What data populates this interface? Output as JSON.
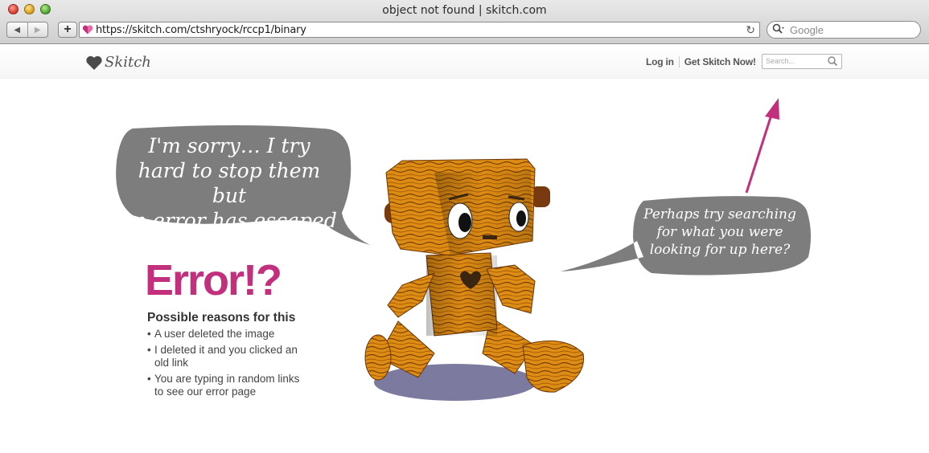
{
  "window": {
    "title": "object not found | skitch.com"
  },
  "toolbar": {
    "back_glyph": "◀",
    "forward_glyph": "▶",
    "add_glyph": "+",
    "url": "https://skitch.com/ctshryock/rccp1/binary",
    "reload_glyph": "↻",
    "search_placeholder": "Google"
  },
  "site": {
    "logo_text": "Skitch",
    "nav": {
      "login": "Log in",
      "get_skitch": "Get Skitch Now!"
    },
    "search_placeholder": "Search..."
  },
  "content": {
    "bubble_left": [
      "I'm sorry… I try",
      "hard to stop them but",
      "an error has escaped"
    ],
    "bubble_right": [
      "Perhaps try searching",
      "for what you were",
      "looking for up here?"
    ],
    "error_title": "Error!?",
    "reasons_heading": "Possible reasons for this",
    "reasons": [
      {
        "bullet": "•",
        "text": "A user deleted the image"
      },
      {
        "bullet": "•",
        "text": "I deleted it and you clicked an old link"
      },
      {
        "bullet": "•",
        "text": "You are typing in random links to see our error page"
      }
    ]
  },
  "colors": {
    "accent_pink": "#c2307d",
    "bubble_gray": "#7d7d7d",
    "shadow_purple": "#7c7a9e",
    "wood": "#d9860f"
  }
}
